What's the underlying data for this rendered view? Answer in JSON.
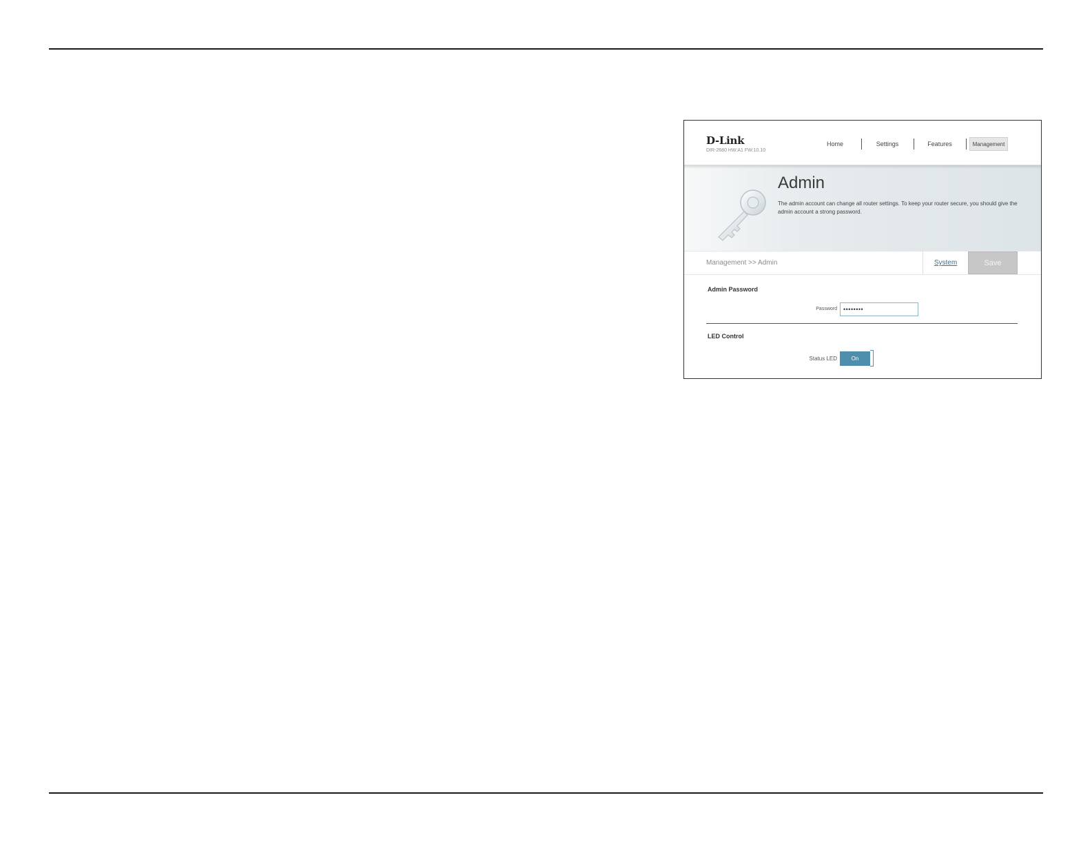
{
  "router": {
    "brand": "D-Link",
    "model_info": "DIR-2680 HW:A1 FW:10.10",
    "nav": {
      "home": "Home",
      "settings": "Settings",
      "features": "Features",
      "management": "Management"
    },
    "banner": {
      "title": "Admin",
      "description": "The admin account can change all router settings. To keep your router secure, you should give the admin account a strong password."
    },
    "breadcrumb": "Management >> Admin",
    "system_link": "System",
    "save_label": "Save",
    "admin_password": {
      "section_title": "Admin Password",
      "password_label": "Password",
      "password_value": "••••••••"
    },
    "led_control": {
      "section_title": "LED Control",
      "status_label": "Status LED",
      "toggle_value": "On"
    },
    "colors": {
      "accent": "#4e8fae",
      "save_disabled": "#c7c7c7",
      "link": "#3a6f8c"
    }
  },
  "icons": {
    "banner_icon": "key-icon"
  }
}
